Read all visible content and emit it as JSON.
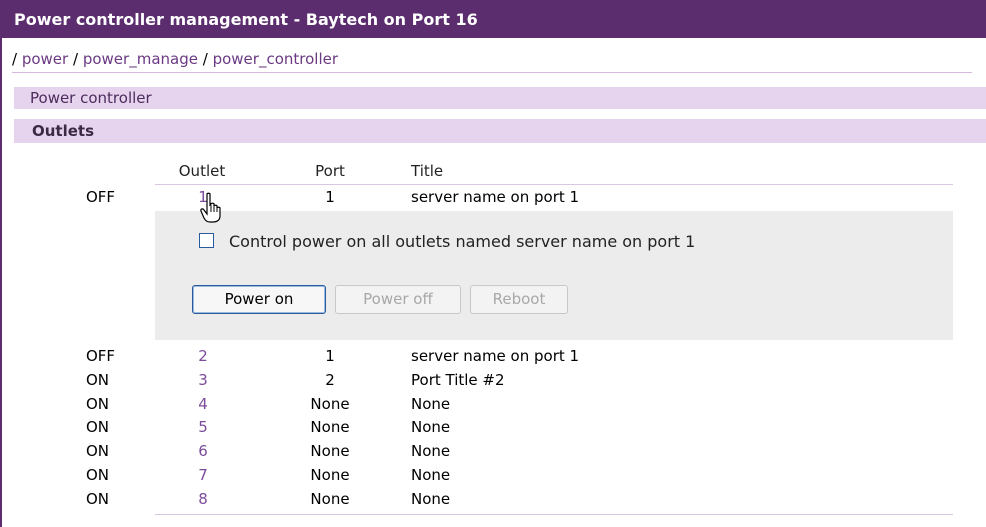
{
  "window": {
    "title": "Power controller management - Baytech on Port 16"
  },
  "breadcrumb": {
    "sep": "/",
    "items": [
      "power",
      "power_manage",
      "power_controller"
    ]
  },
  "sections": {
    "controller": "Power controller",
    "outlets": "Outlets"
  },
  "table": {
    "headers": {
      "outlet": "Outlet",
      "port": "Port",
      "title": "Title"
    },
    "rows": [
      {
        "status": "OFF",
        "outlet": "1",
        "port": "1",
        "title": "server name on port 1"
      },
      {
        "status": "OFF",
        "outlet": "2",
        "port": "1",
        "title": "server name on port 1"
      },
      {
        "status": "ON",
        "outlet": "3",
        "port": "2",
        "title": "Port Title #2"
      },
      {
        "status": "ON",
        "outlet": "4",
        "port": "None",
        "title": "None"
      },
      {
        "status": "ON",
        "outlet": "5",
        "port": "None",
        "title": "None"
      },
      {
        "status": "ON",
        "outlet": "6",
        "port": "None",
        "title": "None"
      },
      {
        "status": "ON",
        "outlet": "7",
        "port": "None",
        "title": "None"
      },
      {
        "status": "ON",
        "outlet": "8",
        "port": "None",
        "title": "None"
      }
    ]
  },
  "control": {
    "checkbox_label": "Control power on all outlets named server name on port 1",
    "buttons": {
      "power_on": "Power on",
      "power_off": "Power off",
      "reboot": "Reboot"
    }
  },
  "colors": {
    "header_bg": "#5c2d6e",
    "section_bg": "#e6d4ee",
    "link": "#7c4b9b"
  }
}
